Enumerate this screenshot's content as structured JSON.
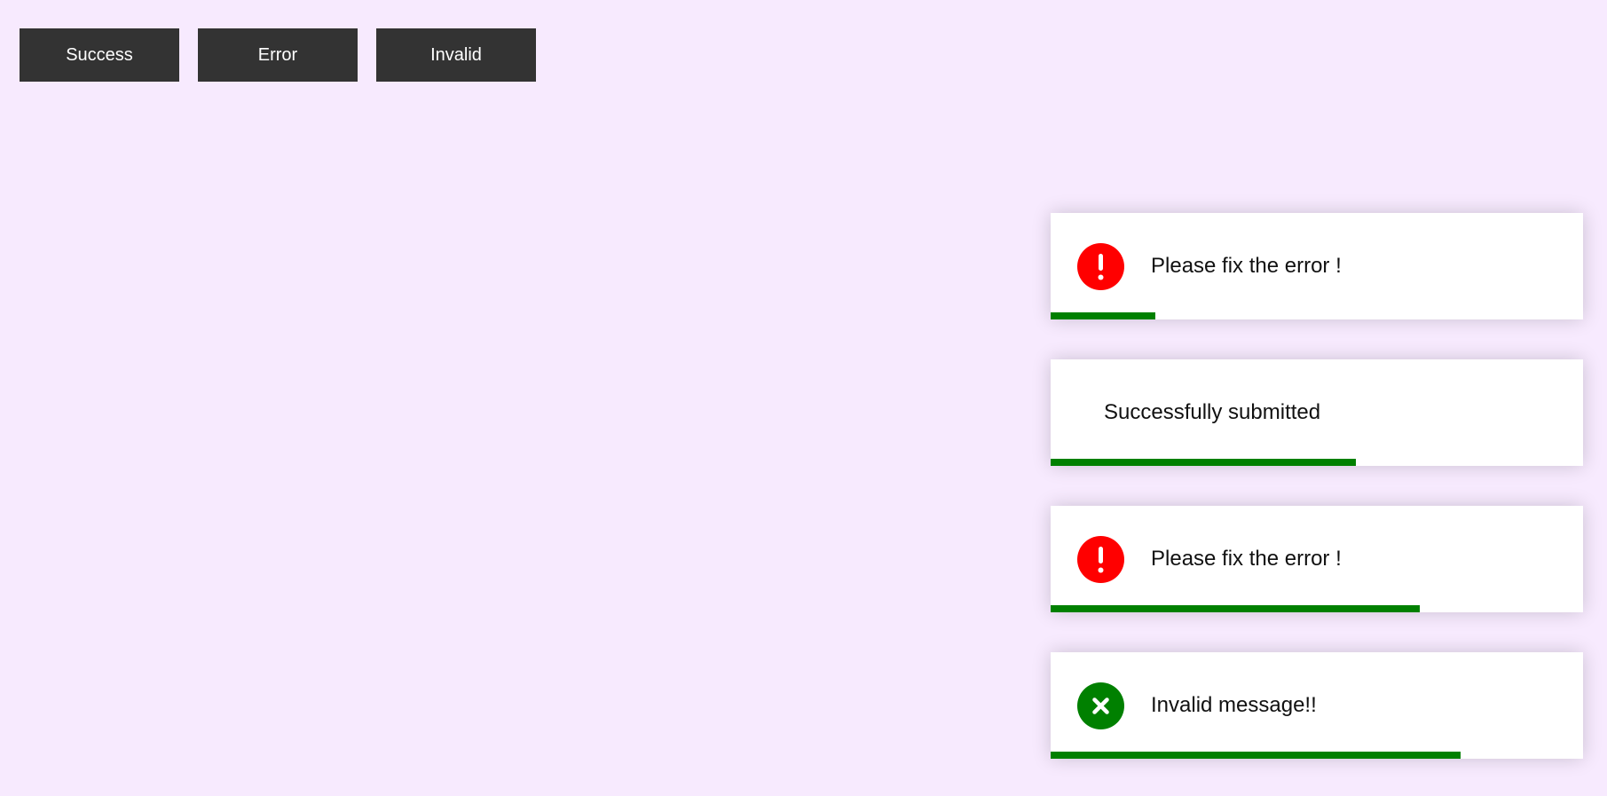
{
  "buttons": {
    "success_label": "Success",
    "error_label": "Error",
    "invalid_label": "Invalid"
  },
  "colors": {
    "page_bg": "#f7eafe",
    "button_bg": "#333333",
    "error_icon": "#ff0000",
    "invalid_icon": "#008000",
    "progress": "#008000"
  },
  "toasts": [
    {
      "type": "error",
      "icon": "exclamation-icon",
      "message": "Please fix the error !",
      "progress": 0.197
    },
    {
      "type": "success",
      "icon": "",
      "message": "Successfully submitted",
      "progress": 0.573
    },
    {
      "type": "error",
      "icon": "exclamation-icon",
      "message": "Please fix the error !",
      "progress": 0.693
    },
    {
      "type": "invalid",
      "icon": "x-mark-icon",
      "message": "Invalid message!!",
      "progress": 0.77
    }
  ]
}
